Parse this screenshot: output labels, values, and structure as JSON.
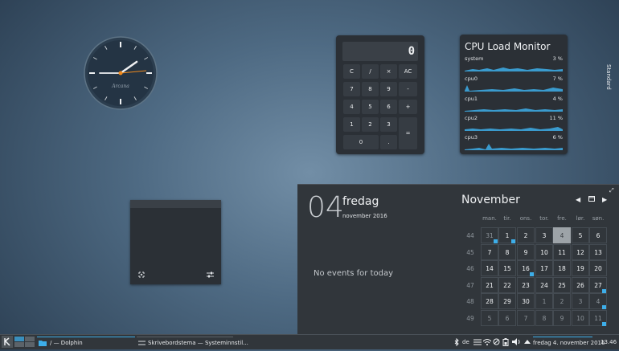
{
  "clock": {
    "brand": "Arcana"
  },
  "calculator": {
    "display": "0",
    "keys": [
      "C",
      "/",
      "×",
      "AC",
      "7",
      "8",
      "9",
      "-",
      "4",
      "5",
      "6",
      "+",
      "1",
      "2",
      "3",
      "=",
      "0",
      "."
    ]
  },
  "cpu_monitor": {
    "title": "CPU Load Monitor",
    "rows": [
      {
        "name": "system",
        "percent": "3 %"
      },
      {
        "name": "cpu0",
        "percent": "7 %"
      },
      {
        "name": "cpu1",
        "percent": "4 %"
      },
      {
        "name": "cpu2",
        "percent": "11 %"
      },
      {
        "name": "cpu3",
        "percent": "6 %"
      }
    ],
    "graph_color": "#3daee9"
  },
  "side_tab": {
    "label": "Standard"
  },
  "calendar": {
    "day_number": "04",
    "day_name": "fredag",
    "month_year": "november 2016",
    "no_events": "No events for today",
    "month_title": "November",
    "prev_icon": "chevron-left-icon",
    "next_icon": "chevron-right-icon",
    "weekday_headers": [
      "man.",
      "tir.",
      "ons.",
      "tor.",
      "fre.",
      "lør.",
      "søn."
    ],
    "weeks": [
      {
        "week": "44",
        "days": [
          "31",
          "1",
          "2",
          "3",
          "4",
          "5",
          "6"
        ]
      },
      {
        "week": "45",
        "days": [
          "7",
          "8",
          "9",
          "10",
          "11",
          "12",
          "13"
        ]
      },
      {
        "week": "46",
        "days": [
          "14",
          "15",
          "16",
          "17",
          "18",
          "19",
          "20"
        ]
      },
      {
        "week": "47",
        "days": [
          "21",
          "22",
          "23",
          "24",
          "25",
          "26",
          "27"
        ]
      },
      {
        "week": "48",
        "days": [
          "28",
          "29",
          "30",
          "1",
          "2",
          "3",
          "4"
        ]
      },
      {
        "week": "49",
        "days": [
          "5",
          "6",
          "7",
          "8",
          "9",
          "10",
          "11"
        ]
      }
    ]
  },
  "taskbar": {
    "task1": "/ — Dolphin",
    "task2": "Skrivebordstema — Systeminnstil...",
    "keyboard_layout": "de",
    "date": "fredag 4. november 2016",
    "time": "13.46"
  },
  "colors": {
    "accent": "#3daee9",
    "panel": "#31363b",
    "widget": "#2b3036"
  }
}
